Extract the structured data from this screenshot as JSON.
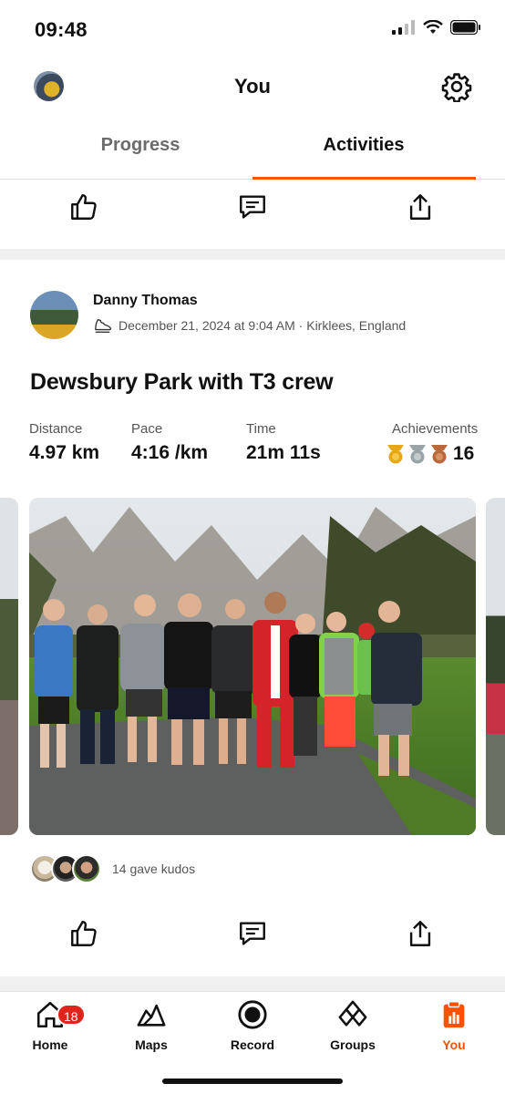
{
  "status_bar": {
    "time": "09:48"
  },
  "header": {
    "title": "You"
  },
  "tabs": [
    {
      "label": "Progress",
      "active": false
    },
    {
      "label": "Activities",
      "active": true
    }
  ],
  "activity": {
    "athlete_name": "Danny Thomas",
    "meta": "December 21, 2024 at 9:04 AM · Kirklees, England",
    "title": "Dewsbury Park with T3 crew",
    "stats": [
      {
        "label": "Distance",
        "value": "4.97 km"
      },
      {
        "label": "Pace",
        "value": "4:16 /km"
      },
      {
        "label": "Time",
        "value": "21m 11s"
      },
      {
        "label": "Achievements",
        "value": "16"
      }
    ],
    "kudos_text": "14 gave kudos"
  },
  "bottom_nav": {
    "items": [
      {
        "label": "Home",
        "icon": "home-icon",
        "badge": "18"
      },
      {
        "label": "Maps",
        "icon": "map-icon"
      },
      {
        "label": "Record",
        "icon": "record-icon"
      },
      {
        "label": "Groups",
        "icon": "groups-icon"
      },
      {
        "label": "You",
        "icon": "you-icon",
        "active": true
      }
    ]
  },
  "colors": {
    "accent": "#fc5200",
    "badge": "#e0241c",
    "gold": "#e6a817",
    "silver": "#9aa4a8",
    "bronze": "#b86a3c"
  }
}
